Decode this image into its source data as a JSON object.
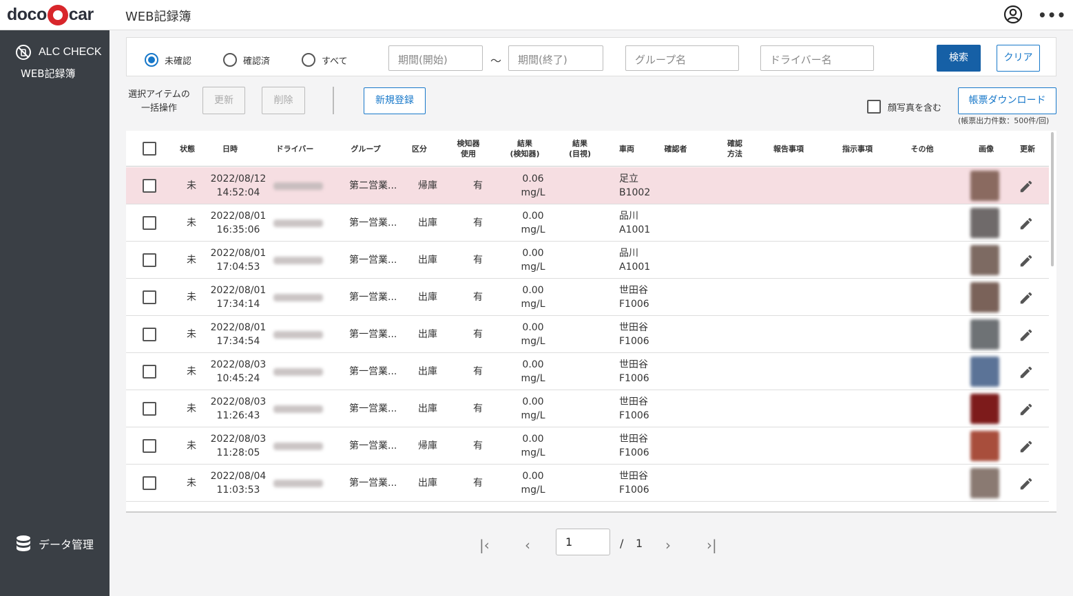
{
  "header": {
    "logo_left": "doco",
    "logo_right": "car",
    "title": "WEB記録簿"
  },
  "sidebar": {
    "alc_label": "ALC CHECK",
    "web_label": "WEB記録簿",
    "data_label": "データ管理"
  },
  "filter": {
    "radios": [
      {
        "label": "未確認",
        "checked": true
      },
      {
        "label": "確認済",
        "checked": false
      },
      {
        "label": "すべて",
        "checked": false
      }
    ],
    "period_start_placeholder": "期間(開始)",
    "tilde": "〜",
    "period_end_placeholder": "期間(終了)",
    "group_placeholder": "グループ名",
    "driver_placeholder": "ドライバー名",
    "search_label": "検索",
    "clear_label": "クリア"
  },
  "actions": {
    "bulk_label_1": "選択アイテムの",
    "bulk_label_2": "一括操作",
    "update_label": "更新",
    "delete_label": "削除",
    "new_label": "新規登録",
    "face_photo_label": "顔写真を含む",
    "download_label": "帳票ダウンロード",
    "download_note": "(帳票出力件数：500件/回)"
  },
  "table": {
    "columns": {
      "status": "状態",
      "datetime": "日時",
      "driver": "ドライバー",
      "group": "グループ",
      "category": "区分",
      "detector_1": "検知器",
      "detector_2": "使用",
      "result_det_1": "結果",
      "result_det_2": "(検知器)",
      "result_vis_1": "結果",
      "result_vis_2": "(目視)",
      "vehicle": "車両",
      "confirmer": "確認者",
      "confirm_1": "確認",
      "confirm_2": "方法",
      "report": "報告事項",
      "instruction": "指示事項",
      "other": "その他",
      "image": "画像",
      "edit": "更新"
    },
    "rows": [
      {
        "status": "未",
        "date": "2022/08/12",
        "time": "14:52:04",
        "group": "第二営業...",
        "category": "帰庫",
        "detector": "有",
        "value": "0.06",
        "unit": "mg/L",
        "vehicle_1": "足立",
        "vehicle_2": "B1002",
        "highlight": true,
        "thumb_color": "#8a6a60"
      },
      {
        "status": "未",
        "date": "2022/08/01",
        "time": "16:35:06",
        "group": "第一営業...",
        "category": "出庫",
        "detector": "有",
        "value": "0.00",
        "unit": "mg/L",
        "vehicle_1": "品川",
        "vehicle_2": "A1001",
        "highlight": false,
        "thumb_color": "#6f6a6a"
      },
      {
        "status": "未",
        "date": "2022/08/01",
        "time": "17:04:53",
        "group": "第一営業...",
        "category": "出庫",
        "detector": "有",
        "value": "0.00",
        "unit": "mg/L",
        "vehicle_1": "品川",
        "vehicle_2": "A1001",
        "highlight": false,
        "thumb_color": "#7d6a62"
      },
      {
        "status": "未",
        "date": "2022/08/01",
        "time": "17:34:14",
        "group": "第一営業...",
        "category": "出庫",
        "detector": "有",
        "value": "0.00",
        "unit": "mg/L",
        "vehicle_1": "世田谷",
        "vehicle_2": "F1006",
        "highlight": false,
        "thumb_color": "#7a6259"
      },
      {
        "status": "未",
        "date": "2022/08/01",
        "time": "17:34:54",
        "group": "第一営業...",
        "category": "出庫",
        "detector": "有",
        "value": "0.00",
        "unit": "mg/L",
        "vehicle_1": "世田谷",
        "vehicle_2": "F1006",
        "highlight": false,
        "thumb_color": "#6e7275"
      },
      {
        "status": "未",
        "date": "2022/08/03",
        "time": "10:45:24",
        "group": "第一営業...",
        "category": "出庫",
        "detector": "有",
        "value": "0.00",
        "unit": "mg/L",
        "vehicle_1": "世田谷",
        "vehicle_2": "F1006",
        "highlight": false,
        "thumb_color": "#5b7397"
      },
      {
        "status": "未",
        "date": "2022/08/03",
        "time": "11:26:43",
        "group": "第一営業...",
        "category": "出庫",
        "detector": "有",
        "value": "0.00",
        "unit": "mg/L",
        "vehicle_1": "世田谷",
        "vehicle_2": "F1006",
        "highlight": false,
        "thumb_color": "#7d1b1b"
      },
      {
        "status": "未",
        "date": "2022/08/03",
        "time": "11:28:05",
        "group": "第一営業...",
        "category": "帰庫",
        "detector": "有",
        "value": "0.00",
        "unit": "mg/L",
        "vehicle_1": "世田谷",
        "vehicle_2": "F1006",
        "highlight": false,
        "thumb_color": "#a84e3c"
      },
      {
        "status": "未",
        "date": "2022/08/04",
        "time": "11:03:53",
        "group": "第一営業...",
        "category": "出庫",
        "detector": "有",
        "value": "0.00",
        "unit": "mg/L",
        "vehicle_1": "世田谷",
        "vehicle_2": "F1006",
        "highlight": false,
        "thumb_color": "#8a7a72"
      }
    ]
  },
  "pagination": {
    "current": "1",
    "separator": "/",
    "total": "1"
  },
  "colors": {
    "sidebar": "#3a3f45",
    "primary": "#1660a6",
    "accent": "#1677c9",
    "highlight_row": "#f6dee2",
    "logo_red": "#d8262b"
  }
}
